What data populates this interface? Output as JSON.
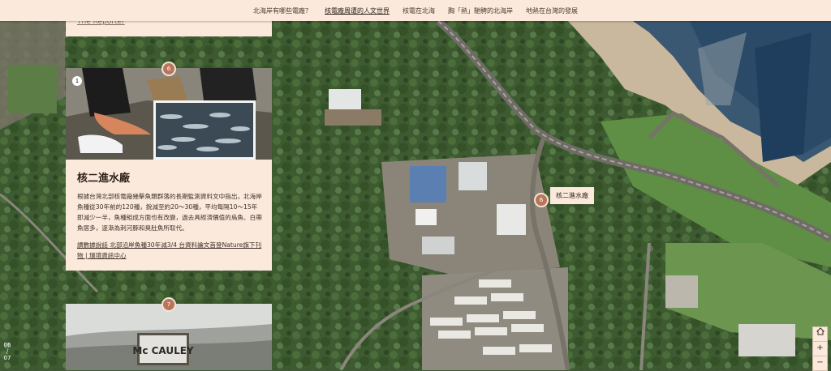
{
  "nav": {
    "items": [
      {
        "label": "北海岸有哪些電廠？",
        "active": false
      },
      {
        "label": "核電廠周遭的人文世界",
        "active": true
      },
      {
        "label": "核電在北海",
        "active": false
      },
      {
        "label": "胸「熱」馳騁的北海岸",
        "active": false
      },
      {
        "label": "地熱在台灣的發展",
        "active": false
      }
    ]
  },
  "top_card": {
    "link_text": "The Reporter"
  },
  "main_card": {
    "marker_number": "6",
    "photo_badge": "1",
    "title": "核二進水廠",
    "description": "根據台灣北部核電廠幾擊魚類群落的長期監測資料文中指出，北海岸魚種從30年前的120種，銳減至約20～30種，平均每隔10～15年即減少一半，魚種組成方面也有改變，過去具經濟價值的烏魚、白帶魚居多，逐漸為刺河豚和臭肚魚所取代。",
    "read_more": "讀數據說話 北部沿岸魚種30年減3/4 台資料論文首登Nature旗下刊物 | 環境資訊中心"
  },
  "bottom_card": {
    "marker_number": "7",
    "sign_text": "Mc CAULEY"
  },
  "map_marker": {
    "number": "6",
    "label": "核二進水廠"
  },
  "progress": {
    "current": "06",
    "total": "07"
  },
  "zoom": {
    "home_icon": "home-icon",
    "plus": "+",
    "minus": "−"
  }
}
